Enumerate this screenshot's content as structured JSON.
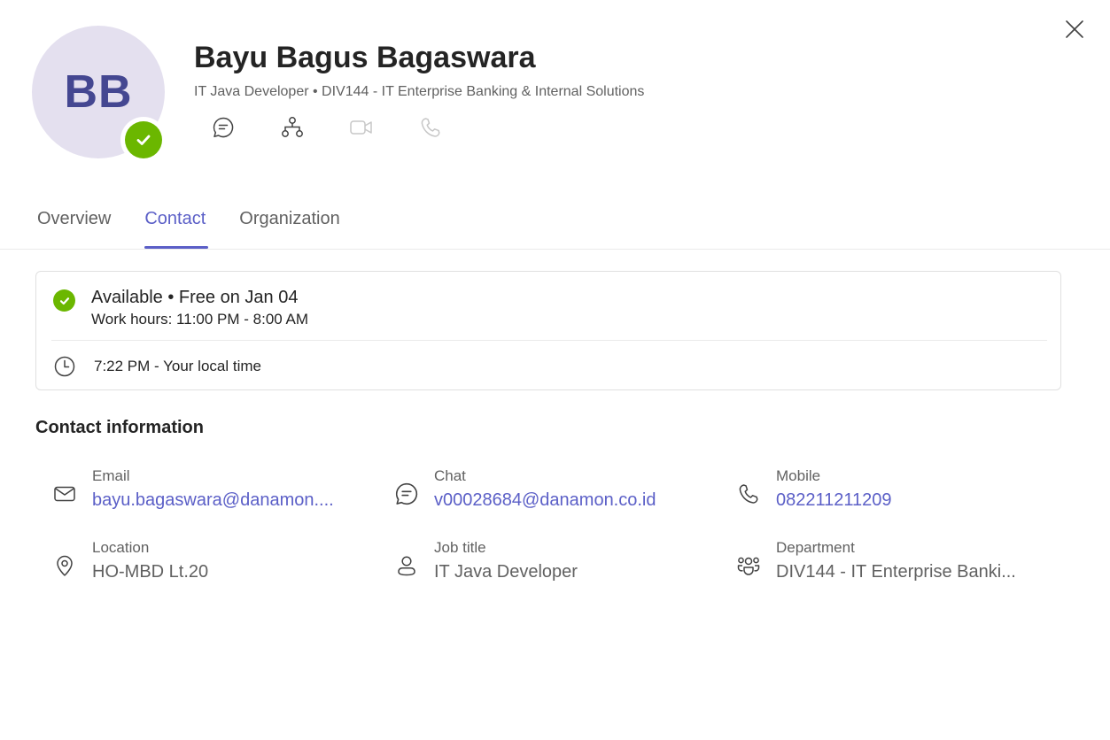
{
  "profile": {
    "initials": "BB",
    "name": "Bayu Bagus Bagaswara",
    "subtitle": "IT Java Developer • DIV144 - IT Enterprise Banking & Internal Solutions",
    "presence_color": "#6bb700"
  },
  "actions": [
    {
      "icon": "chat-icon",
      "enabled": true
    },
    {
      "icon": "org-chart-icon",
      "enabled": true
    },
    {
      "icon": "video-call-icon",
      "enabled": false
    },
    {
      "icon": "phone-call-icon",
      "enabled": false
    }
  ],
  "tabs": [
    {
      "label": "Overview",
      "active": false
    },
    {
      "label": "Contact",
      "active": true
    },
    {
      "label": "Organization",
      "active": false
    }
  ],
  "status": {
    "main": "Available • Free on Jan 04",
    "work_hours": "Work hours: 11:00 PM - 8:00 AM",
    "local_time": "7:22 PM - Your local time"
  },
  "contact_info": {
    "title": "Contact information",
    "email": {
      "label": "Email",
      "value": "bayu.bagaswara@danamon...."
    },
    "chat": {
      "label": "Chat",
      "value": "v00028684@danamon.co.id"
    },
    "mobile": {
      "label": "Mobile",
      "value": "082211211209"
    },
    "location": {
      "label": "Location",
      "value": "HO-MBD Lt.20"
    },
    "job_title": {
      "label": "Job title",
      "value": "IT Java Developer"
    },
    "department": {
      "label": "Department",
      "value": "DIV144 - IT Enterprise Banki..."
    }
  },
  "colors": {
    "accent": "#5b5fc7",
    "available": "#6bb700",
    "avatar_bg": "#e4e0ef",
    "avatar_text": "#444791"
  }
}
